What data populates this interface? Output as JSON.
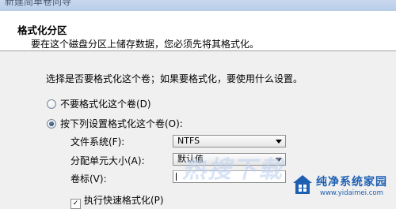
{
  "window": {
    "title": "新建简单卷向导"
  },
  "header": {
    "title": "格式化分区",
    "description": "要在这个磁盘分区上储存数据，您必须先将其格式化。"
  },
  "instruction": "选择是否要格式化这个卷；如果要格式化，要使用什么设置。",
  "options": {
    "no_format": {
      "label": "不要格式化这个卷(D)",
      "selected": false
    },
    "format": {
      "label": "按下列设置格式化这个卷(O):",
      "selected": true
    }
  },
  "fields": {
    "file_system": {
      "label": "文件系统(F):",
      "value": "NTFS"
    },
    "allocation_unit": {
      "label": "分配单元大小(A):",
      "value": "默认值"
    },
    "volume_label": {
      "label": "卷标(V):",
      "value": ""
    }
  },
  "quick_format": {
    "label": "执行快速格式化(P)",
    "checked": true
  },
  "watermark": {
    "big_text": "热搜下载",
    "site_name": "纯净系统家园",
    "site_url": "www.yidaimei.com",
    "color": "#1d5fb3"
  }
}
